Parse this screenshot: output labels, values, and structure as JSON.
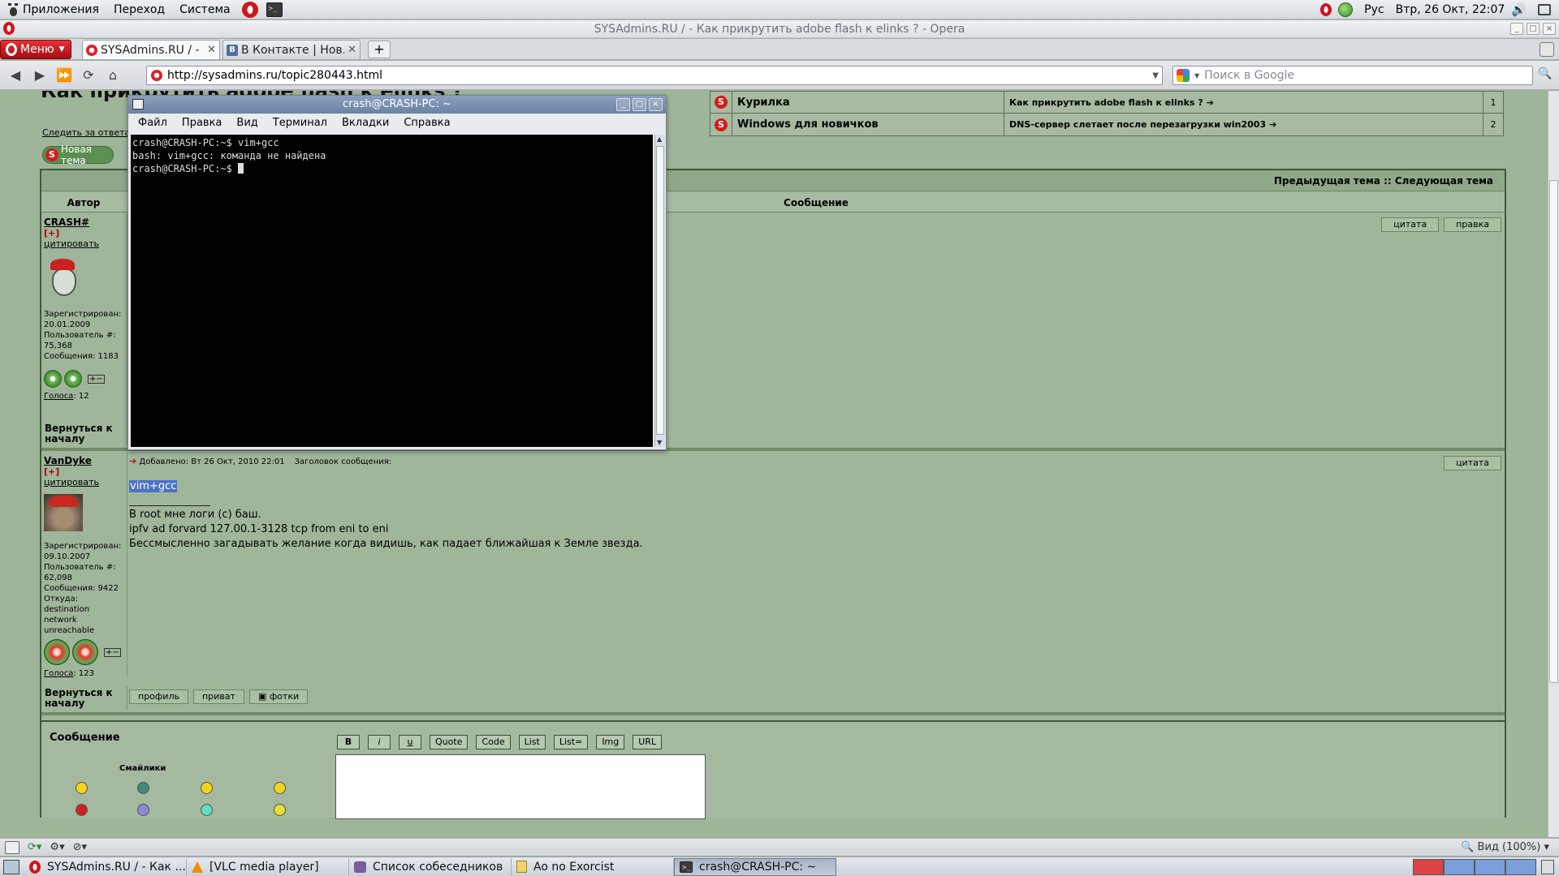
{
  "top_panel": {
    "menus": [
      "Приложения",
      "Переход",
      "Система"
    ],
    "lang": "Рус",
    "clock": "Втр, 26 Окт, 22:07"
  },
  "opera": {
    "window_title": "SYSAdmins.RU / - Как прикрутить adobe flash к elinks ? - Opera",
    "menu_label": "Меню",
    "tabs": [
      {
        "label": "SYSAdmins.RU / - ..."
      },
      {
        "label": "В Контакте | Нов..."
      }
    ],
    "address": "http://sysadmins.ru/topic280443.html",
    "search_placeholder": "Поиск в Google",
    "zoom_label": "Вид (100%)"
  },
  "page": {
    "heading": "Как прикрутить adobe flash к elinks ?",
    "watch_link": "Следить за ответами",
    "new_topic": "Новая тема",
    "related": [
      {
        "forum": "Курилка",
        "topic": "Как прикрутить adobe flash к elinks ?",
        "count": "1"
      },
      {
        "forum": "Windows для новичков",
        "topic": "DNS-сервер слетает после перезагрузки win2003",
        "count": "2"
      }
    ],
    "prevnext": "Предыдущая тема :: Следующая тема",
    "col_author": "Автор",
    "col_message": "Сообщение",
    "back_to_top": "Вернуться к началу",
    "posts": [
      {
        "author": "CRASH#",
        "plus": "[+]",
        "quote": "цитировать",
        "registered": "Зарегистрирован: 20.01.2009",
        "user_no": "Пользователь #: 75,368",
        "messages": "Сообщения: 1183",
        "votes_label": "Голоса",
        "votes": ": 12",
        "buttons": [
          "цитата",
          "правка"
        ]
      },
      {
        "author": "VanDyke",
        "plus": "[+]",
        "quote": "цитировать",
        "added": "Добавлено: Вт 26 Окт, 2010 22:01",
        "subject_label": "Заголовок сообщения:",
        "registered": "Зарегистрирован: 09.10.2007",
        "user_no": "Пользователь #: 62,098",
        "messages": "Сообщения: 9422",
        "from_label": "Откуда:",
        "from": "destination network unreachable",
        "votes_label": "Голоса",
        "votes": ": 123",
        "buttons": [
          "цитата"
        ],
        "body": "vim+gcc",
        "signature": [
          "В root мне логи (с) баш.",
          "ipfv ad forvard 127.00.1-3128 tcp from eni to eni",
          "Бессмысленно загадывать желание когда видишь, как падает ближайшая к Земле звезда."
        ],
        "footer_buttons": [
          "профиль",
          "приват",
          "фотки"
        ]
      }
    ],
    "reply": {
      "title": "Сообщение",
      "smiles_title": "Смайлики",
      "format_buttons": [
        "B",
        "i",
        "u",
        "Quote",
        "Code",
        "List",
        "List=",
        "Img",
        "URL"
      ]
    }
  },
  "terminal": {
    "title": "crash@CRASH-PC: ~",
    "menu": [
      "Файл",
      "Правка",
      "Вид",
      "Терминал",
      "Вкладки",
      "Справка"
    ],
    "lines": [
      "crash@CRASH-PC:~$ vim+gcc",
      "bash: vim+gcc: команда не найдена",
      "crash@CRASH-PC:~$ "
    ]
  },
  "taskbar": [
    {
      "label": "SYSAdmins.RU / - Как ...",
      "icon": "opera-icon"
    },
    {
      "label": "[VLC media player]",
      "icon": "vlc-icon"
    },
    {
      "label": "Список собеседников",
      "icon": "pidgin-icon"
    },
    {
      "label": "Ao no Exorcist",
      "icon": "document-icon"
    },
    {
      "label": "crash@CRASH-PC: ~",
      "icon": "terminal-icon",
      "active": true
    }
  ]
}
